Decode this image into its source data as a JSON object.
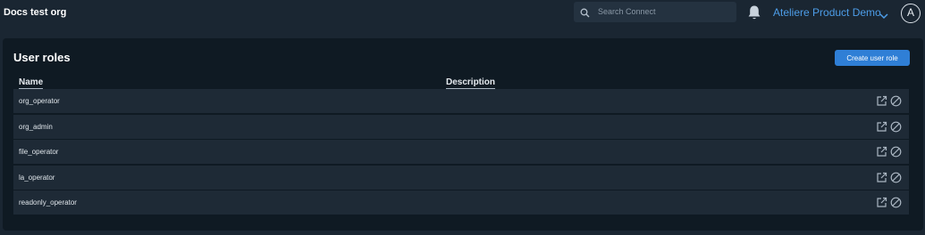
{
  "header": {
    "org_name": "Docs test org",
    "search_placeholder": "Search Connect",
    "product_name": "Ateliere Product Demo",
    "avatar_initial": "A"
  },
  "main": {
    "title": "User roles",
    "create_button_label": "Create user role",
    "columns": [
      "Name",
      "Description"
    ],
    "rows": [
      {
        "name": "org_operator",
        "description": ""
      },
      {
        "name": "org_admin",
        "description": ""
      },
      {
        "name": "file_operator",
        "description": ""
      },
      {
        "name": "la_operator",
        "description": ""
      },
      {
        "name": "readonly_operator",
        "description": ""
      }
    ]
  },
  "colors": {
    "background": "#1a2632",
    "panel": "#0f1a23",
    "row": "#1e2a36",
    "accent": "#2f7fd6",
    "product_link": "#4d9de8"
  },
  "icons": {
    "search": "search-icon",
    "notifications": "bell-icon",
    "menu": "chevron-down-icon",
    "row_edit": "edit-icon",
    "row_disable": "disable-icon"
  }
}
